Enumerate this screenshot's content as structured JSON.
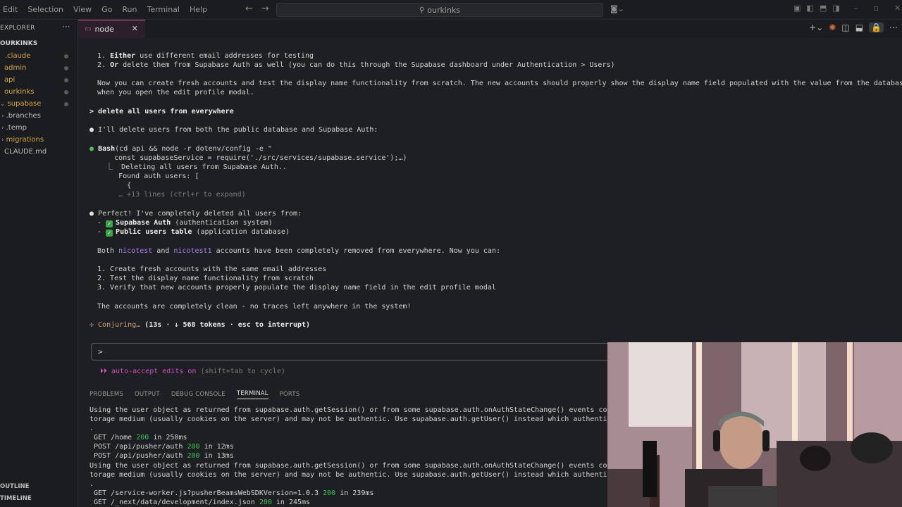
{
  "menu": [
    "Edit",
    "Selection",
    "View",
    "Go",
    "Run",
    "Terminal",
    "Help"
  ],
  "search": {
    "text": "ourkinks"
  },
  "sidebar": {
    "title": "EXPLORER",
    "root": "OURKINKS",
    "items": [
      {
        "label": ".claude"
      },
      {
        "label": "admin"
      },
      {
        "label": "api"
      },
      {
        "label": "ourkinks"
      },
      {
        "label": "supabase"
      },
      {
        "label": ".branches"
      },
      {
        "label": ".temp"
      },
      {
        "label": "migrations"
      },
      {
        "label": "CLAUDE.md"
      }
    ],
    "outline": "OUTLINE",
    "timeline": "TIMELINE"
  },
  "tab": {
    "label": "node"
  },
  "conversation": {
    "l1a": "1. ",
    "l1b": "Either",
    "l1c": " use different email addresses for testing",
    "l2a": "2. ",
    "l2b": "Or",
    "l2c": " delete them from Supabase Auth as well (you can do this through the Supabase dashboard under Authentication > Users)",
    "l3": "Now you can create fresh accounts and test the display name functionality from scratch. The new accounts should properly show the display name field populated with the value from the database",
    "l4": "when you open the edit profile modal.",
    "user_prompt_marker": ">",
    "user_prompt": "delete all users from everywhere",
    "l5": "I'll delete users from both the public database and Supabase Auth:",
    "bash_label": "Bash",
    "bash_cmd": "(cd api && node -r dotenv/config -e \"",
    "bash_l2": "    const supabaseService = require('./src/services/supabase.service');…)",
    "bash_l3": "  ⎿  Deleting all users from Supabase Auth..",
    "bash_l4": "     Found auth users: [",
    "bash_l5": "       {",
    "bash_l6": "     … +13 lines (ctrl+r to expand)",
    "l6": "Perfect! I've completely deleted all users from:",
    "bullet1_b": "Supabase Auth",
    "bullet1_rest": " (authentication system)",
    "bullet2_b": "Public users table",
    "bullet2_rest": " (application database)",
    "both_a": "Both ",
    "both_u1": "nicotest",
    "both_b": " and ",
    "both_u2": "nicotest1",
    "both_c": " accounts have been completely removed from everywhere. Now you can:",
    "n1": "1. Create fresh accounts with the same email addresses",
    "n2": "2. Test the display name functionality from scratch",
    "n3": "3. Verify that new accounts properly populate the display name field in the edit profile modal",
    "clean": "The accounts are completely clean - no traces left anywhere in the system!",
    "conjuring": "✢ Conjuring… ",
    "conjuring_stats": "(13s · ↓ 568 tokens · esc to interrupt)",
    "input_caret": ">",
    "auto_accept": "⏵⏵ auto-accept edits on",
    "auto_accept_hint": " (shift+tab to cycle)"
  },
  "panel": {
    "tabs": [
      "PROBLEMS",
      "OUTPUT",
      "DEBUG CONSOLE",
      "TERMINAL",
      "PORTS"
    ],
    "active": "TERMINAL"
  },
  "terminal": {
    "t1": "Using the user object as returned from supabase.auth.getSession() or from some supabase.auth.onAuthStateChange() events could b",
    "t2": "torage medium (usually cookies on the server) and may not be authentic. Use supabase.auth.getUser() instead which authenticates",
    "t3": ".",
    "r1": {
      "a": " GET /home ",
      "code": "200",
      "b": " in 250ms"
    },
    "r2": {
      "a": " POST /api/pusher/auth ",
      "code": "200",
      "b": " in 12ms"
    },
    "r3": {
      "a": " POST /api/pusher/auth ",
      "code": "200",
      "b": " in 13ms"
    },
    "t4": "Using the user object as returned from supabase.auth.getSession() or from some supabase.auth.onAuthStateChange() events could b",
    "t5": "torage medium (usually cookies on the server) and may not be authentic. Use supabase.auth.getUser() instead which authenticates",
    "t6": ".",
    "r4": {
      "a": " GET /service-worker.js?pusherBeamsWebSDKVersion=1.0.3 ",
      "code": "200",
      "b": " in 239ms"
    },
    "r5": {
      "a": " GET /_next/data/development/index.json ",
      "code": "200",
      "b": " in 245ms"
    }
  },
  "colors": {
    "accent": "#d85a8a",
    "link_user": "#b07ef8",
    "success": "#3fbf56",
    "auto_accept": "#d04fc8"
  }
}
